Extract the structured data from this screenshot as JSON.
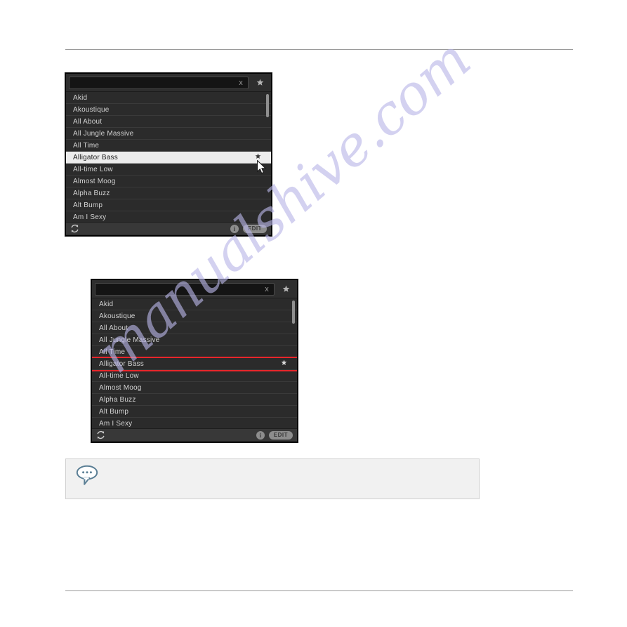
{
  "page": {
    "watermark": "manualshive.com",
    "rules": {
      "top": true,
      "bottom": true
    }
  },
  "colors": {
    "panel_bg": "#2b2b2b",
    "row_text": "#d2d2d2",
    "selected_bg": "#ececec",
    "selected_text": "#1b1b1b",
    "annotation_red": "#e8262b",
    "footer_bg": "#383838",
    "note_bg": "#f1f1f1",
    "note_border": "#d0d0d0",
    "note_icon": "#5b7f95",
    "watermark": "#b9b6e8"
  },
  "browser_panel_1": {
    "search": {
      "value": "",
      "placeholder": "",
      "clear_label": "x",
      "clear_icon": "close-x-icon",
      "favorite_icon": "star-icon"
    },
    "items": [
      {
        "label": "Akid",
        "selected": false,
        "starred": false
      },
      {
        "label": "Akoustique",
        "selected": false,
        "starred": false
      },
      {
        "label": "All About",
        "selected": false,
        "starred": false
      },
      {
        "label": "All Jungle Massive",
        "selected": false,
        "starred": false
      },
      {
        "label": "All Time",
        "selected": false,
        "starred": false
      },
      {
        "label": "Alligator Bass",
        "selected": true,
        "starred": true
      },
      {
        "label": "All-time Low",
        "selected": false,
        "starred": false
      },
      {
        "label": "Almost Moog",
        "selected": false,
        "starred": false
      },
      {
        "label": "Alpha Buzz",
        "selected": false,
        "starred": false
      },
      {
        "label": "Alt Bump",
        "selected": false,
        "starred": false
      },
      {
        "label": "Am I Sexy",
        "selected": false,
        "starred": false
      }
    ],
    "footer": {
      "sync_icon": "sync-refresh-icon",
      "info_icon": "info-icon",
      "info_label": "i",
      "edit_label": "EDIT"
    },
    "scrollbar": {
      "visible": true
    },
    "cursor": {
      "icon": "mouse-pointer-arrow-icon"
    }
  },
  "browser_panel_2": {
    "search": {
      "value": "",
      "placeholder": "",
      "clear_label": "x",
      "clear_icon": "close-x-icon",
      "favorite_icon": "star-icon"
    },
    "items": [
      {
        "label": "Akid",
        "annotated": false,
        "starred": false
      },
      {
        "label": "Akoustique",
        "annotated": false,
        "starred": false
      },
      {
        "label": "All About",
        "annotated": false,
        "starred": false
      },
      {
        "label": "All Jungle Massive",
        "annotated": false,
        "starred": false
      },
      {
        "label": "All Time",
        "annotated": false,
        "starred": false
      },
      {
        "label": "Alligator Bass",
        "annotated": true,
        "starred": true
      },
      {
        "label": "All-time Low",
        "annotated": false,
        "starred": false
      },
      {
        "label": "Almost Moog",
        "annotated": false,
        "starred": false
      },
      {
        "label": "Alpha Buzz",
        "annotated": false,
        "starred": false
      },
      {
        "label": "Alt Bump",
        "annotated": false,
        "starred": false
      },
      {
        "label": "Am I Sexy",
        "annotated": false,
        "starred": false
      }
    ],
    "footer": {
      "sync_icon": "sync-refresh-icon",
      "info_icon": "info-icon",
      "info_label": "i",
      "edit_label": "EDIT"
    },
    "scrollbar": {
      "visible": true
    }
  },
  "note_callout": {
    "icon": "speech-bubble-ellipsis-icon",
    "text": ""
  }
}
